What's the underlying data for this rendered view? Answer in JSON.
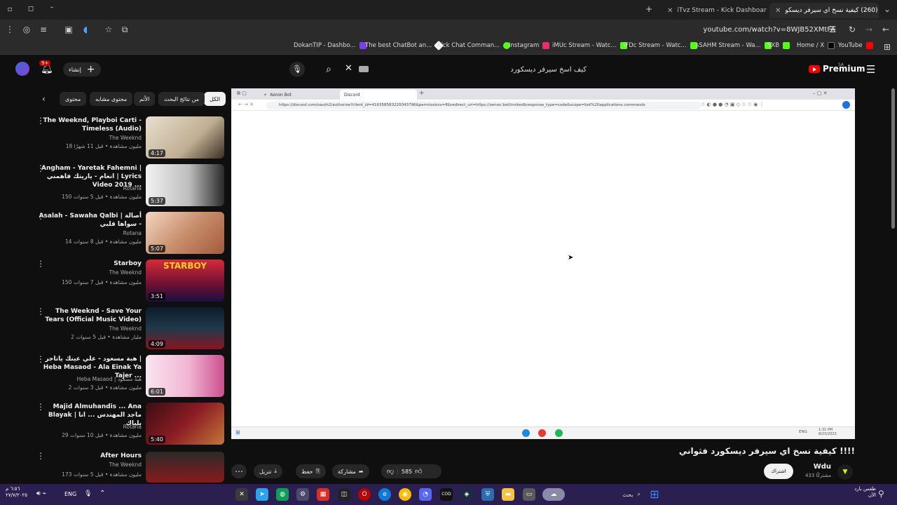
{
  "browser": {
    "tabs": [
      {
        "label": "iTvz Stream - Kick Dashboard",
        "icon": "kick-icon"
      },
      {
        "label": "(260) كيفية نسخ اي سيرفر ديسكو",
        "icon": "youtube-icon"
      }
    ],
    "url": "youtube.com/watch?v=8WJB52XMtFA",
    "bookmarks": [
      {
        "label": "DokanTIP - Dashbo...",
        "icon": "purple"
      },
      {
        "label": "The best ChatBot an...",
        "icon": "white"
      },
      {
        "label": "Kick Chat Comman...",
        "icon": "green"
      },
      {
        "label": "Instagram",
        "icon": "pink"
      },
      {
        "label": "iMUc Stream - Watc...",
        "icon": "green"
      },
      {
        "label": "iFDc Stream - Watc...",
        "icon": "green"
      },
      {
        "label": "sSAHM Stream - Wa...",
        "icon": "green"
      },
      {
        "label": "SXB",
        "icon": "green"
      },
      {
        "label": "Home / X",
        "icon": "black"
      },
      {
        "label": "YouTube",
        "icon": "red"
      }
    ]
  },
  "youtube": {
    "brand": "Premium",
    "region": "SA",
    "search_value": "كيف اسخ سيرفر ديسكورد",
    "create_label": "إنشاء",
    "notif_count": "9+",
    "chips": [
      "الكل",
      "من نتائج البحث",
      "الأثم",
      "محتوى مشابه",
      "محتوى"
    ]
  },
  "sidebar_videos": [
    {
      "title": "The Weeknd, Playboi Carti - Timeless (Audio)",
      "channel": "The Weeknd",
      "meta": "18 مليون مشاهدة • قبل 11 شهرًا",
      "duration": "4:17"
    },
    {
      "title": "Angham - Yaretak Fahemni | انغام - ياريتك فاهمني | Lyrics Video 2019 ...",
      "channel": "Rotana",
      "meta": "150 مليون مشاهدة • قبل 5 سنوات",
      "duration": "5:37"
    },
    {
      "title": "Asalah - Sawaha Qalbi | أصالة - سواها قلبي",
      "channel": "Rotana",
      "meta": "14 مليون مشاهدة • قبل 8 سنوات",
      "duration": "5:07"
    },
    {
      "title": "Starboy",
      "channel": "The Weeknd",
      "meta": "150 مليون مشاهدة • قبل 7 سنوات",
      "duration": "3:51"
    },
    {
      "title": "The Weeknd - Save Your Tears (Official Music Video)",
      "channel": "The Weeknd",
      "meta": "2 مليار مشاهدة • قبل 5 سنوات",
      "duration": "4:09"
    },
    {
      "title": "هبة مسعود - علي عينك ياتاجر | Heba Masaod - Ala Einak Ya Tajer ...",
      "channel": "Heba Masaod | هبة مسعود",
      "meta": "2 مليون مشاهدة • قبل 3 سنوات",
      "duration": "6:01"
    },
    {
      "title": "Majid Almuhandis ... Ana Blayak | ماجد المهندس ... انا بلياك",
      "channel": "Rotana",
      "meta": "29 مليون مشاهدة • قبل 10 سنوات",
      "duration": "5:40"
    },
    {
      "title": "After Hours",
      "channel": "The Weeknd",
      "meta": "173 مليون مشاهدة • قبل 5 سنوات",
      "duration": ""
    }
  ],
  "player": {
    "inner_tabs": [
      "Xenon Bot",
      "Discord"
    ],
    "inner_url": "https://discord.com/oauth2/authorize?client_id=416358583220043796&permissions=8&redirect_uri=https://xenon.bot/invited&response_type=code&scope=bot%20applications.commands",
    "inner_clock": "1:31 PM\n8/23/2023",
    "inner_lang": "ENG"
  },
  "video": {
    "title": "كيفية نسخ اي سيرفر ديسكورد فثواني !!!!",
    "likes": "585",
    "share_label": "مشاركة",
    "save_label": "حفظ",
    "download_label": "تنزيل",
    "subscribe_label": "اشتراك",
    "channel": "Wdu",
    "subscribers": "433 مشتركًا"
  },
  "taskbar": {
    "search_label": "بحث",
    "time": "٦:٥٦ م",
    "date": "٢٧/٧/٢٠٢٥",
    "lang": "ENG",
    "weather": "طقس بارد\nالآن"
  }
}
